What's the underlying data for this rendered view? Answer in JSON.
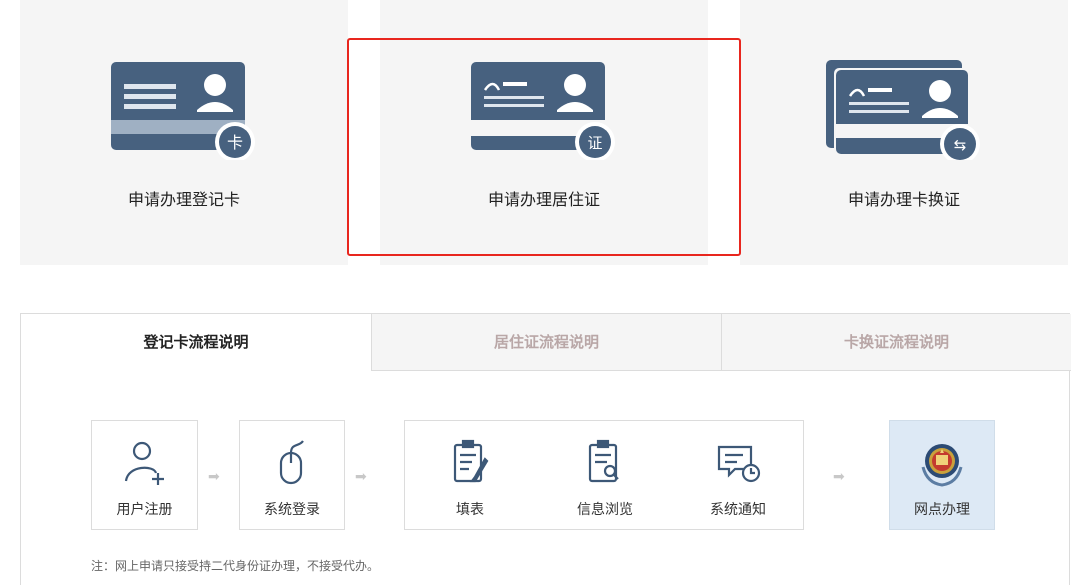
{
  "cards": [
    {
      "label": "申请办理登记卡",
      "badge": "卡"
    },
    {
      "label": "申请办理居住证",
      "badge": "证"
    },
    {
      "label": "申请办理卡换证",
      "badge": "⇆"
    }
  ],
  "tabs": [
    {
      "label": "登记卡流程说明",
      "active": true
    },
    {
      "label": "居住证流程说明",
      "active": false
    },
    {
      "label": "卡换证流程说明",
      "active": false
    }
  ],
  "steps": [
    {
      "label": "用户注册",
      "icon": "add-user-icon"
    },
    {
      "label": "系统登录",
      "icon": "mouse-icon"
    },
    {
      "label": "填表",
      "icon": "form-edit-icon"
    },
    {
      "label": "信息浏览",
      "icon": "clipboard-search-icon"
    },
    {
      "label": "系统通知",
      "icon": "message-clock-icon"
    },
    {
      "label": "网点办理",
      "icon": "police-emblem-icon"
    }
  ],
  "arrow_glyph": "➡",
  "note": "注：网上申请只接受持二代身份证办理，不接受代办。",
  "colors": {
    "card_blue": "#47617f",
    "highlight": "#e8261e",
    "icon_blue": "#3d5877",
    "blue_step_bg": "#dde9f5"
  }
}
